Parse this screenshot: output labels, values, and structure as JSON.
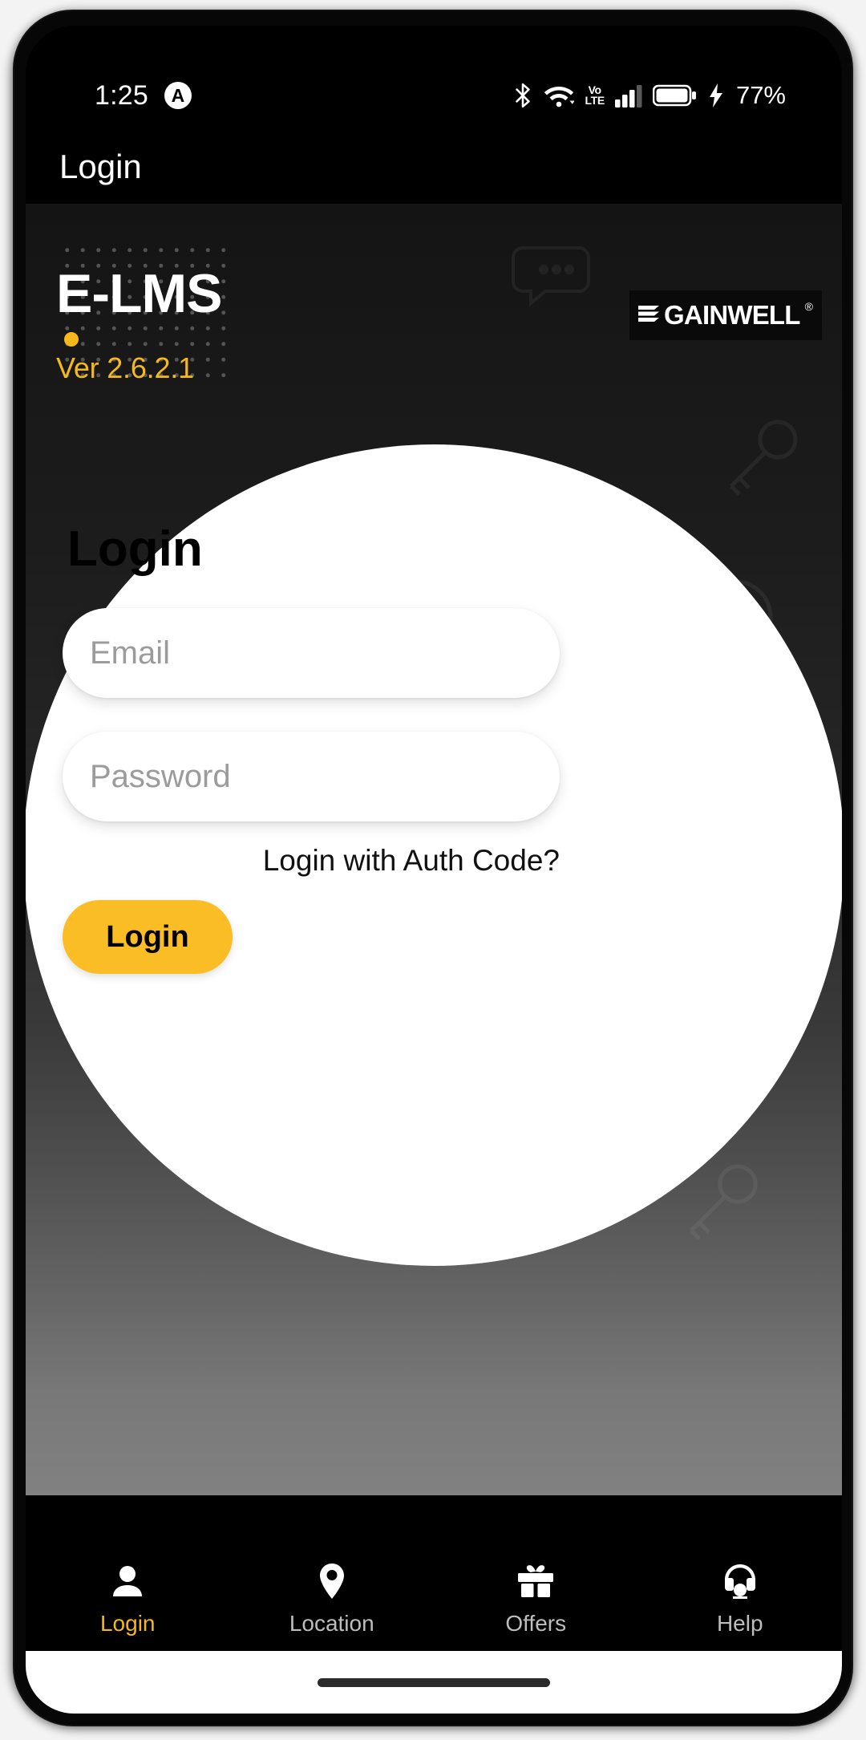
{
  "statusbar": {
    "time": "1:25",
    "app_icon": "A",
    "battery_text": "77%",
    "icons": [
      "bluetooth-icon",
      "wifi-icon",
      "volte-icon",
      "signal-icon",
      "battery-charging-icon"
    ],
    "volte_top": "Vo",
    "volte_bottom": "LTE"
  },
  "appbar": {
    "title": "Login"
  },
  "hero": {
    "brand_name": "E-LMS",
    "version": "Ver 2.6.2.1",
    "partner_logo_text": "GAINWELL",
    "partner_logo_reg": "®"
  },
  "form": {
    "heading": "Login",
    "email_placeholder": "Email",
    "email_value": "",
    "password_placeholder": "Password",
    "password_value": "",
    "auth_code_link": "Login with Auth Code?",
    "submit_label": "Login"
  },
  "bottomnav": {
    "items": [
      {
        "label": "Login",
        "icon": "person-icon",
        "active": true
      },
      {
        "label": "Location",
        "icon": "location-icon",
        "active": false
      },
      {
        "label": "Offers",
        "icon": "gift-icon",
        "active": false
      },
      {
        "label": "Help",
        "icon": "headset-icon",
        "active": false
      }
    ]
  },
  "colors": {
    "accent": "#fbbd26",
    "accent_text": "#f5b91e",
    "background": "#000000",
    "panel": "#ffffff"
  }
}
